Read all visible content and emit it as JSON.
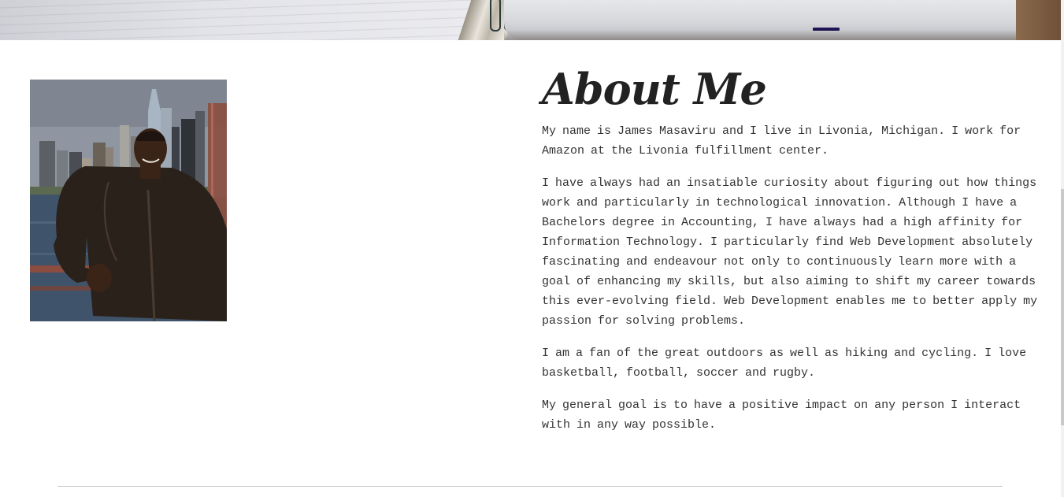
{
  "about": {
    "title": "About Me",
    "paragraphs": [
      "My name is James Masaviru and I live in Livonia, Michigan. I work for Amazon at the Livonia fulfillment center.",
      "I have always had an insatiable curiosity about figuring out how things work and particularly in technological innovation. Although I have a Bachelors degree in Accounting, I have always had a high affinity for Information Technology. I particularly find Web Development absolutely fascinating and endeavour not only to continuously learn more with a goal of enhancing my skills, but also aiming to shift my career towards this ever-evolving field. Web Development enables me to better apply my passion for solving problems.",
      "I am a fan of the great outdoors as well as hiking and cycling. I love basketball, football, soccer and rugby.",
      "My general goal is to have a positive impact on any person I interact with in any way possible."
    ]
  },
  "colors": {
    "heading": "#222222",
    "body_text": "#333333",
    "divider": "#cccccc",
    "background": "#ffffff"
  },
  "icons": {
    "banner": "desk-notebook-laptop-image",
    "photo": "profile-photo-city-skyline"
  }
}
